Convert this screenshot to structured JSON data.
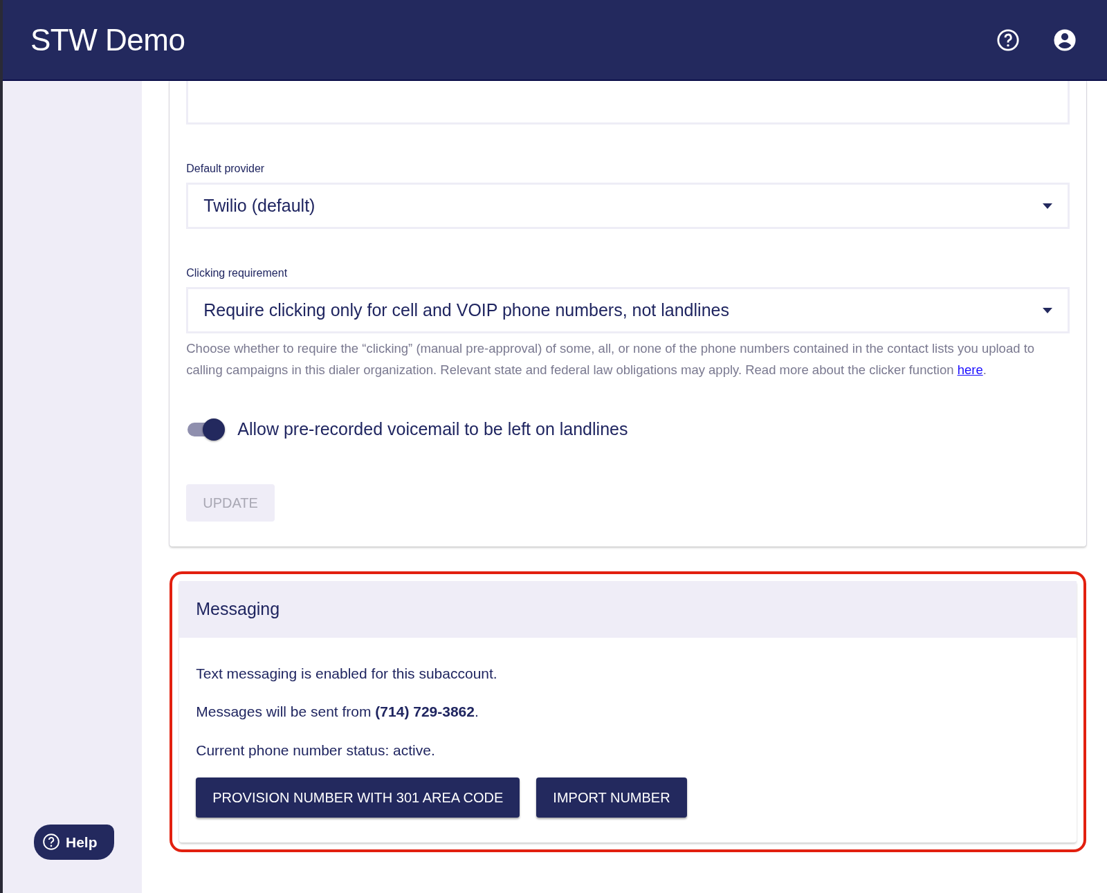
{
  "app_bar": {
    "title": "STW Demo"
  },
  "sidebar": {
    "help_button": {
      "label": "Help"
    }
  },
  "settings_card": {
    "fields": [
      {
        "kind": "text"
      },
      {
        "kind": "select",
        "label": "Default provider",
        "value": "Twilio (default)"
      },
      {
        "kind": "select",
        "label": "Clicking requirement",
        "value": "Require clicking only for cell and VOIP phone numbers, not landlines",
        "help_text": "Choose whether to require the “clicking” (manual pre-approval) of some, all, or none of the phone numbers contained in the contact lists you upload to calling campaigns in this dialer organization. Relevant state and federal law obligations may apply. Read more about the clicker function ",
        "help_link": "here",
        "help_end": "."
      }
    ],
    "toggle": {
      "label": "Allow pre-recorded voicemail to be left on landlines",
      "on": true
    },
    "update_button": {
      "label": "UPDATE",
      "disabled": true
    }
  },
  "messaging_card": {
    "title": "Messaging",
    "highlighted": true,
    "lines": [
      "Text messaging is enabled for this subaccount.",
      "Messages will be sent from **(714) 729-3862**.",
      "Current phone number status: active."
    ],
    "buttons": [
      "PROVISION NUMBER WITH 301 AREA CODE",
      "IMPORT NUMBER"
    ]
  }
}
